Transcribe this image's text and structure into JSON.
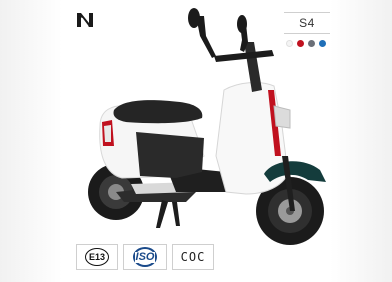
{
  "product": {
    "model": "S4",
    "colors": [
      {
        "name": "white",
        "hex": "#f4f4f4"
      },
      {
        "name": "red",
        "hex": "#c0111f"
      },
      {
        "name": "gray",
        "hex": "#6b6f78"
      },
      {
        "name": "blue",
        "hex": "#1f6fb8"
      }
    ]
  },
  "brand": {
    "logo_icon": "brand-n-logo-icon"
  },
  "certifications": [
    {
      "label": "E13",
      "icon": "e13-mark-icon"
    },
    {
      "label": "ISO",
      "icon": "iso-mark-icon"
    },
    {
      "label": "COC",
      "icon": "coc-mark-icon"
    }
  ],
  "theme": {
    "body_color": "#ffffff",
    "seat_color": "#2a2a2a",
    "accent_red": "#c0111f",
    "accent_teal": "#143c3c"
  }
}
